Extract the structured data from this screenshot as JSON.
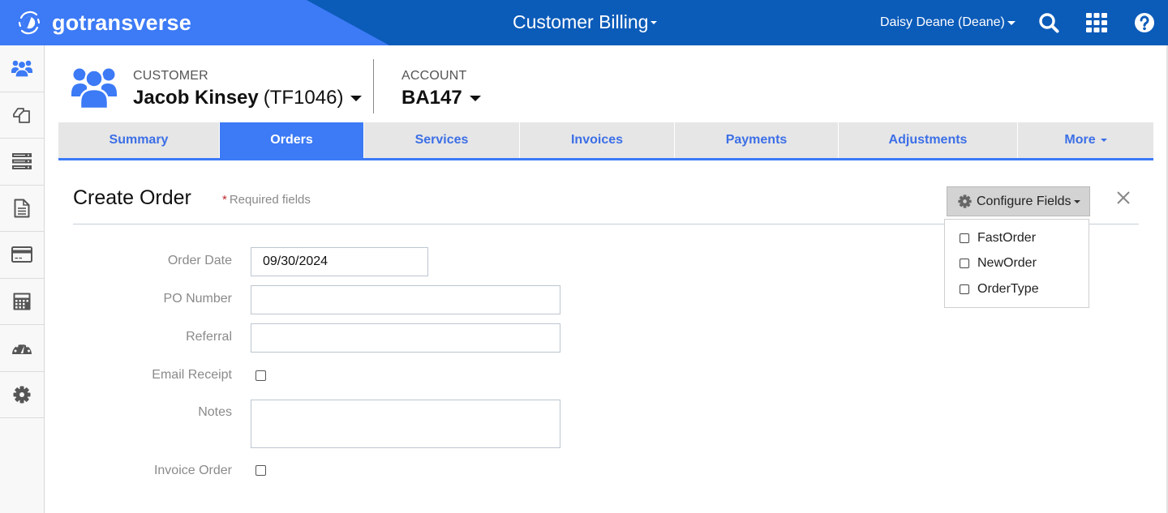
{
  "header": {
    "logo_text": "gotransverse",
    "app_title": "Customer Billing",
    "user_name": "Daisy Deane (Deane)",
    "icons": [
      "search-icon",
      "apps-grid-icon",
      "help-icon"
    ],
    "colors": {
      "brand_blue": "#3c7af6",
      "header_dark": "#0b5bb9"
    }
  },
  "sidebar": {
    "items": [
      {
        "name": "customers",
        "icon": "users-icon",
        "active": true
      },
      {
        "name": "documents",
        "icon": "copy-documents-icon",
        "active": false
      },
      {
        "name": "services",
        "icon": "server-list-icon",
        "active": false
      },
      {
        "name": "invoices",
        "icon": "file-text-icon",
        "active": false
      },
      {
        "name": "payments",
        "icon": "credit-card-icon",
        "active": false
      },
      {
        "name": "calculator",
        "icon": "calculator-icon",
        "active": false
      },
      {
        "name": "dashboard",
        "icon": "dashboard-gauge-icon",
        "active": false
      },
      {
        "name": "settings",
        "icon": "gear-icon",
        "active": false
      }
    ]
  },
  "customer": {
    "label": "CUSTOMER",
    "name": "Jacob Kinsey",
    "id": "(TF1046)"
  },
  "account": {
    "label": "ACCOUNT",
    "number": "BA147"
  },
  "tabs": [
    {
      "label": "Summary",
      "active": false
    },
    {
      "label": "Orders",
      "active": true
    },
    {
      "label": "Services",
      "active": false
    },
    {
      "label": "Invoices",
      "active": false
    },
    {
      "label": "Payments",
      "active": false
    },
    {
      "label": "Adjustments",
      "active": false
    },
    {
      "label": "More",
      "active": false,
      "dropdown": true
    }
  ],
  "form": {
    "title": "Create Order",
    "required_star": "*",
    "required_note": "Required fields",
    "configure_button": "Configure Fields",
    "configure_menu": [
      {
        "label": "FastOrder",
        "checked": false
      },
      {
        "label": "NewOrder",
        "checked": false
      },
      {
        "label": "OrderType",
        "checked": false
      }
    ],
    "fields": {
      "order_date": {
        "label": "Order Date",
        "value": "09/30/2024"
      },
      "po_number": {
        "label": "PO Number",
        "value": ""
      },
      "referral": {
        "label": "Referral",
        "value": ""
      },
      "email_receipt": {
        "label": "Email Receipt",
        "checked": false
      },
      "notes": {
        "label": "Notes",
        "value": ""
      },
      "invoice_order": {
        "label": "Invoice Order",
        "checked": false
      }
    }
  }
}
